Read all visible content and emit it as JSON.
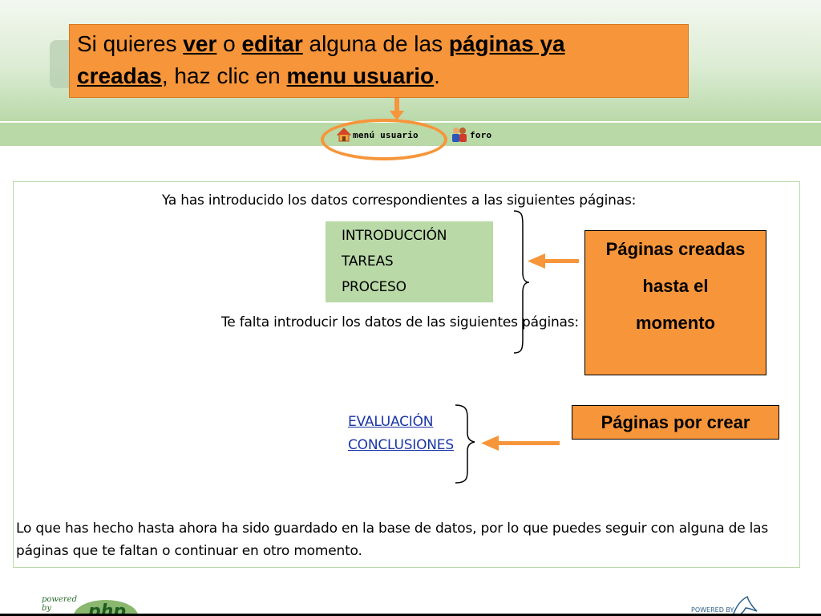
{
  "callout_top": {
    "t1": "Si quieres ",
    "ver": "ver",
    "t2": " o ",
    "editar": "editar",
    "t3": " alguna de las ",
    "paginas_ya": "páginas ya",
    "creadas": "creadas",
    "t4": ", haz clic en ",
    "menu_usuario": "menu usuario",
    "t5": "."
  },
  "nav": {
    "menu_usuario_label": "menú usuario",
    "foro_label": "foro"
  },
  "main": {
    "intro": "Ya has introducido los datos correspondientes a las siguientes páginas:",
    "created_pages": [
      "INTRODUCCIÓN",
      "TAREAS",
      "PROCESO"
    ],
    "missing": "Te falta introducir los datos de las siguientes páginas:",
    "pending_pages": [
      "EVALUACIÓN",
      "CONCLUSIONES"
    ],
    "saved_note": "Lo que has hecho hasta ahora ha sido guardado en la base de datos, por lo que puedes seguir con alguna de las páginas que te faltan o continuar en otro momento."
  },
  "annotations": {
    "created_line1": "Páginas creadas",
    "created_line2": "hasta el",
    "created_line3": "momento",
    "to_create": "Páginas por crear"
  },
  "footer": {
    "php_powered": "powered",
    "php_by": "by",
    "php_word": "php",
    "mysql_powered": "POWERED BY"
  },
  "colors": {
    "callout_orange": "#f7953a",
    "nav_green": "#b9d9a7",
    "link_blue": "#1a35a8"
  }
}
